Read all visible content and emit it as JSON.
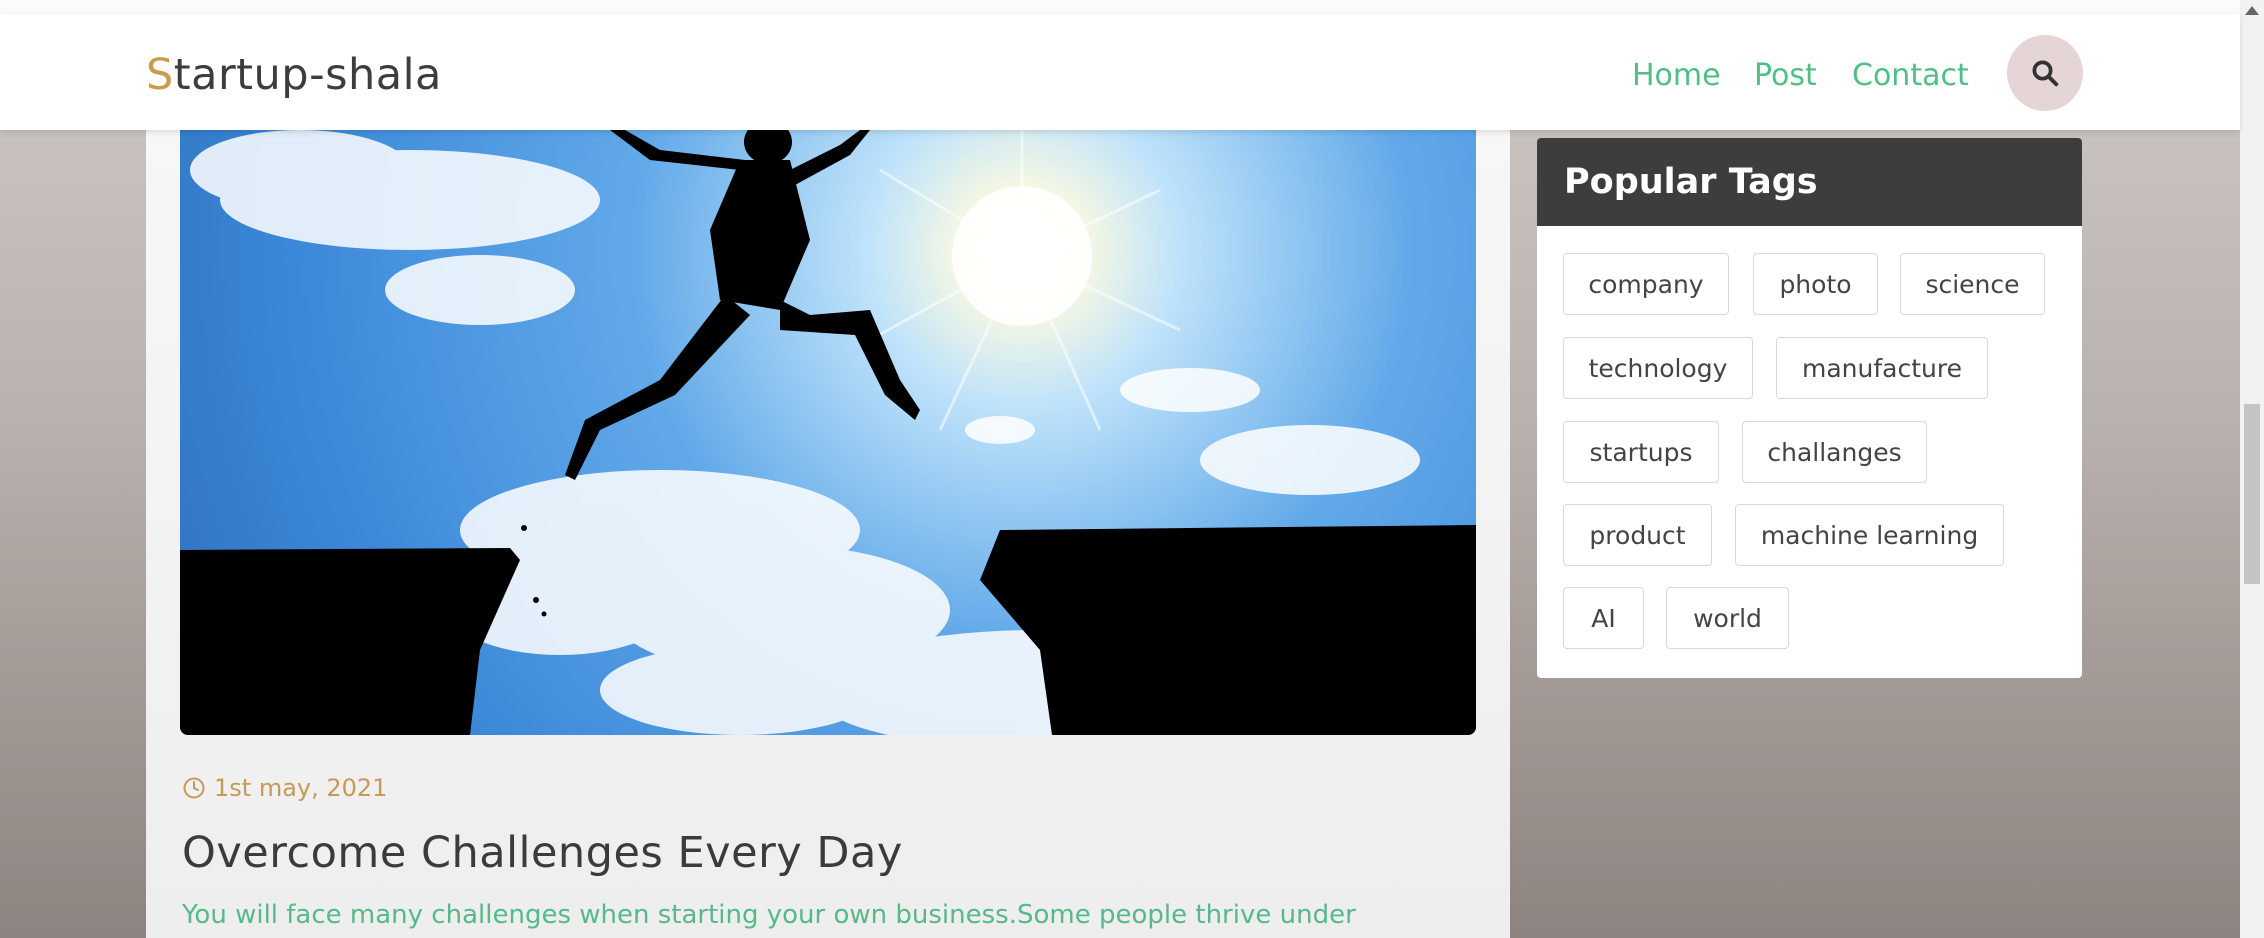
{
  "brand": {
    "first_letter": "S",
    "rest": "tartup-shala"
  },
  "nav": {
    "home": "Home",
    "post": "Post",
    "contact": "Contact"
  },
  "post": {
    "date": "1st may, 2021",
    "title": "Overcome Challenges Every Day",
    "excerpt": "You will face many challenges when starting your own business.Some people thrive under"
  },
  "sidebar": {
    "tags_title": "Popular Tags",
    "tags": [
      "company",
      "photo",
      "science",
      "technology",
      "manufacture",
      "startups",
      "challanges",
      "product",
      "machine learning",
      "AI",
      "world"
    ]
  },
  "colors": {
    "accent_green": "#4fbf86",
    "brand_gold": "#cc9a4d",
    "date_gold": "#c59a55",
    "widget_header": "#3d3d3d"
  },
  "icons": {
    "search": "search-icon",
    "clock": "clock-icon",
    "scroll_up": "scroll-up-arrow-icon"
  }
}
